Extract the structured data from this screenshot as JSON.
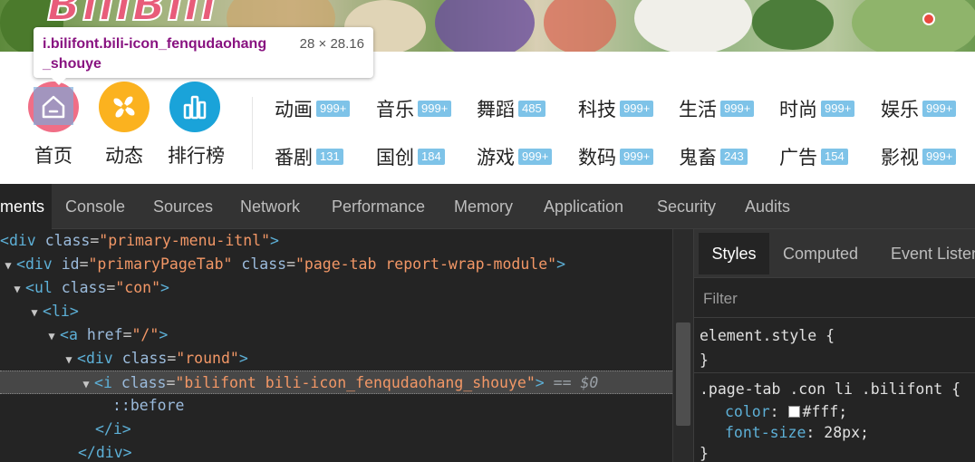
{
  "banner": {
    "logo_text": "BiliBili"
  },
  "tooltip": {
    "selector_line1": "i.bilifont.bili-icon_fenqudaohang",
    "selector_line2": "_shouye",
    "dimensions": "28 × 28.16"
  },
  "primary_nav": [
    {
      "label": "首页",
      "color": "#f06e86",
      "icon": "home-icon"
    },
    {
      "label": "动态",
      "color": "#fbb21f",
      "icon": "pinwheel-icon"
    },
    {
      "label": "排行榜",
      "color": "#1aa3d9",
      "icon": "bar-chart-icon"
    }
  ],
  "categories_row1": [
    {
      "name": "动画",
      "count": "999+"
    },
    {
      "name": "音乐",
      "count": "999+"
    },
    {
      "name": "舞蹈",
      "count": "485"
    },
    {
      "name": "科技",
      "count": "999+"
    },
    {
      "name": "生活",
      "count": "999+"
    },
    {
      "name": "时尚",
      "count": "999+"
    },
    {
      "name": "娱乐",
      "count": "999+"
    }
  ],
  "categories_row2": [
    {
      "name": "番剧",
      "count": "131"
    },
    {
      "name": "国创",
      "count": "184"
    },
    {
      "name": "游戏",
      "count": "999+"
    },
    {
      "name": "数码",
      "count": "999+"
    },
    {
      "name": "鬼畜",
      "count": "243"
    },
    {
      "name": "广告",
      "count": "154"
    },
    {
      "name": "影视",
      "count": "999+"
    }
  ],
  "devtools": {
    "tabs": [
      "ments",
      "Console",
      "Sources",
      "Network",
      "Performance",
      "Memory",
      "Application",
      "Security",
      "Audits"
    ],
    "active_tab": "ments",
    "dom": {
      "l1_tag": "div",
      "l1_attr": "class",
      "l1_val": "\"primary-menu-itnl\"",
      "l2_tag": "div",
      "l2_attr1": "id",
      "l2_val1": "\"primaryPageTab\"",
      "l2_attr2": "class",
      "l2_val2": "\"page-tab report-wrap-module\"",
      "l3_tag": "ul",
      "l3_attr": "class",
      "l3_val": "\"con\"",
      "l4_tag": "li",
      "l5_tag": "a",
      "l5_attr": "href",
      "l5_val": "\"/\"",
      "l6_tag": "div",
      "l6_attr": "class",
      "l6_val": "\"round\"",
      "l7_tag": "i",
      "l7_attr": "class",
      "l7_val": "\"bilifont bili-icon_fenqudaohang_shouye\"",
      "l7_eq": "== $0",
      "l8_text": "::before",
      "l9_close": "</i>",
      "l10_close": "</div>"
    },
    "styles_tabs": [
      "Styles",
      "Computed",
      "Event Listen"
    ],
    "filter_placeholder": "Filter",
    "css": {
      "element_style_selector": "element.style {",
      "close_brace": "}",
      "rule_selector": ".page-tab .con li .bilifont {",
      "prop1_name": "color",
      "prop1_value": "#fff;",
      "prop2_name": "font-size",
      "prop2_value": "28px;",
      "rule_close": "}"
    }
  }
}
